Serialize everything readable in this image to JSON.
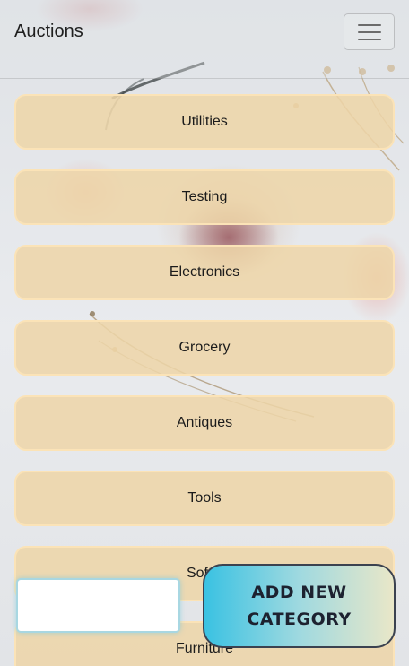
{
  "navbar": {
    "brand": "Auctions",
    "menu_icon": "hamburger-menu-icon"
  },
  "categories": [
    {
      "label": "Utilities"
    },
    {
      "label": "Testing"
    },
    {
      "label": "Electronics"
    },
    {
      "label": "Grocery"
    },
    {
      "label": "Antiques"
    },
    {
      "label": "Tools"
    },
    {
      "label": "Softw"
    },
    {
      "label": "Furniture"
    }
  ],
  "overlay": {
    "add_button_label": "ADD NEW CATEGORY",
    "add_button_gradient": [
      "#3ac2e2",
      "#e9e7c8"
    ]
  },
  "colors": {
    "category_fill": "#eed5a8",
    "category_border": "#fbe3b7"
  }
}
